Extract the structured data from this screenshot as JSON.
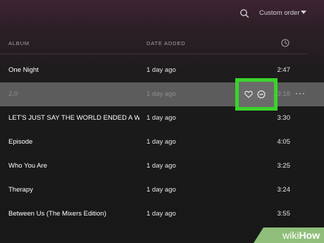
{
  "toolbar": {
    "search_icon": "search-icon",
    "sort_label": "Custom order",
    "sort_icon": "caret-down-icon"
  },
  "header": {
    "album": "ALBUM",
    "date_added": "DATE ADDED",
    "duration_icon": "clock-icon"
  },
  "rows": [
    {
      "title": "One Night",
      "date": "1 day ago",
      "duration": "2:47"
    },
    {
      "title": "2.0",
      "date": "1 day ago",
      "duration": "3:18",
      "highlighted": true,
      "actions": [
        "heart-icon",
        "minus-circle-icon",
        "more-icon"
      ]
    },
    {
      "title": "LET'S JUST SAY THE WORLD ENDED A WEE...",
      "date": "1 day ago",
      "duration": "3:30"
    },
    {
      "title": "Episode",
      "date": "1 day ago",
      "duration": "4:05"
    },
    {
      "title": "Who You Are",
      "date": "1 day ago",
      "duration": "3:25"
    },
    {
      "title": "Therapy",
      "date": "1 day ago",
      "duration": "3:24"
    },
    {
      "title": "Between Us (The Mixers Edition)",
      "date": "1 day ago",
      "duration": "3:55"
    }
  ],
  "colors": {
    "highlight_box": "#39d42a",
    "highlight_row": "#5c5c5c",
    "background": "#181818"
  },
  "watermark": {
    "part1": "wiki",
    "part2": "How"
  }
}
